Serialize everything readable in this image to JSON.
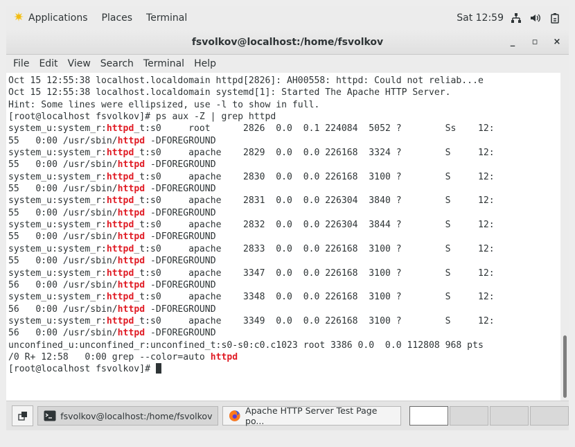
{
  "top_panel": {
    "applications": "Applications",
    "places": "Places",
    "terminal": "Terminal",
    "clock": "Sat 12:59",
    "icons": [
      "network-icon",
      "volume-icon",
      "battery-icon"
    ]
  },
  "window": {
    "title": "fsvolkov@localhost:/home/fsvolkov",
    "controls": {
      "minimize": "_",
      "maximize": "▫",
      "close": "×"
    }
  },
  "menubar": [
    "File",
    "Edit",
    "View",
    "Search",
    "Terminal",
    "Help"
  ],
  "terminal": {
    "lines": [
      [
        {
          "t": "Oct 15 12:55:38 localhost.localdomain httpd[2826]: AH00558: httpd: Could not reliab...e"
        }
      ],
      [
        {
          "t": "Oct 15 12:55:38 localhost.localdomain systemd[1]: Started The Apache HTTP Server."
        }
      ],
      [
        {
          "t": "Hint: Some lines were ellipsized, use -l to show in full."
        }
      ],
      [
        {
          "t": "[root@localhost fsvolkov]# ps aux -Z | grep httpd"
        }
      ],
      [
        {
          "t": "system_u:system_r:"
        },
        {
          "t": "httpd",
          "h": true
        },
        {
          "t": "_t:s0     root      2826  0.0  0.1 224084  5052 ?        Ss    12:"
        }
      ],
      [
        {
          "t": "55   0:00 /usr/sbin/"
        },
        {
          "t": "httpd",
          "h": true
        },
        {
          "t": " -DFOREGROUND"
        }
      ],
      [
        {
          "t": "system_u:system_r:"
        },
        {
          "t": "httpd",
          "h": true
        },
        {
          "t": "_t:s0     apache    2829  0.0  0.0 226168  3324 ?        S     12:"
        }
      ],
      [
        {
          "t": "55   0:00 /usr/sbin/"
        },
        {
          "t": "httpd",
          "h": true
        },
        {
          "t": " -DFOREGROUND"
        }
      ],
      [
        {
          "t": "system_u:system_r:"
        },
        {
          "t": "httpd",
          "h": true
        },
        {
          "t": "_t:s0     apache    2830  0.0  0.0 226168  3100 ?        S     12:"
        }
      ],
      [
        {
          "t": "55   0:00 /usr/sbin/"
        },
        {
          "t": "httpd",
          "h": true
        },
        {
          "t": " -DFOREGROUND"
        }
      ],
      [
        {
          "t": "system_u:system_r:"
        },
        {
          "t": "httpd",
          "h": true
        },
        {
          "t": "_t:s0     apache    2831  0.0  0.0 226304  3840 ?        S     12:"
        }
      ],
      [
        {
          "t": "55   0:00 /usr/sbin/"
        },
        {
          "t": "httpd",
          "h": true
        },
        {
          "t": " -DFOREGROUND"
        }
      ],
      [
        {
          "t": "system_u:system_r:"
        },
        {
          "t": "httpd",
          "h": true
        },
        {
          "t": "_t:s0     apache    2832  0.0  0.0 226304  3844 ?        S     12:"
        }
      ],
      [
        {
          "t": "55   0:00 /usr/sbin/"
        },
        {
          "t": "httpd",
          "h": true
        },
        {
          "t": " -DFOREGROUND"
        }
      ],
      [
        {
          "t": "system_u:system_r:"
        },
        {
          "t": "httpd",
          "h": true
        },
        {
          "t": "_t:s0     apache    2833  0.0  0.0 226168  3100 ?        S     12:"
        }
      ],
      [
        {
          "t": "55   0:00 /usr/sbin/"
        },
        {
          "t": "httpd",
          "h": true
        },
        {
          "t": " -DFOREGROUND"
        }
      ],
      [
        {
          "t": "system_u:system_r:"
        },
        {
          "t": "httpd",
          "h": true
        },
        {
          "t": "_t:s0     apache    3347  0.0  0.0 226168  3100 ?        S     12:"
        }
      ],
      [
        {
          "t": "56   0:00 /usr/sbin/"
        },
        {
          "t": "httpd",
          "h": true
        },
        {
          "t": " -DFOREGROUND"
        }
      ],
      [
        {
          "t": "system_u:system_r:"
        },
        {
          "t": "httpd",
          "h": true
        },
        {
          "t": "_t:s0     apache    3348  0.0  0.0 226168  3100 ?        S     12:"
        }
      ],
      [
        {
          "t": "56   0:00 /usr/sbin/"
        },
        {
          "t": "httpd",
          "h": true
        },
        {
          "t": " -DFOREGROUND"
        }
      ],
      [
        {
          "t": "system_u:system_r:"
        },
        {
          "t": "httpd",
          "h": true
        },
        {
          "t": "_t:s0     apache    3349  0.0  0.0 226168  3100 ?        S     12:"
        }
      ],
      [
        {
          "t": "56   0:00 /usr/sbin/"
        },
        {
          "t": "httpd",
          "h": true
        },
        {
          "t": " -DFOREGROUND"
        }
      ],
      [
        {
          "t": "unconfined_u:unconfined_r:unconfined_t:s0-s0:c0.c1023 root 3386 0.0  0.0 112808 968 pts"
        }
      ],
      [
        {
          "t": "/0 R+ 12:58   0:00 grep --color=auto "
        },
        {
          "t": "httpd",
          "h": true
        }
      ],
      [
        {
          "t": "[root@localhost fsvolkov]# "
        },
        {
          "cursor": true
        }
      ]
    ]
  },
  "taskbar": {
    "tasks": [
      {
        "label": "fsvolkov@localhost:/home/fsvolkov",
        "icon": "terminal-icon",
        "active": true
      },
      {
        "label": "Apache HTTP Server Test Page po...",
        "icon": "firefox-icon",
        "active": false
      }
    ],
    "workspaces": 4,
    "current_workspace": 1
  },
  "colors": {
    "highlight": "#e01b24",
    "text": "#2e3436"
  }
}
